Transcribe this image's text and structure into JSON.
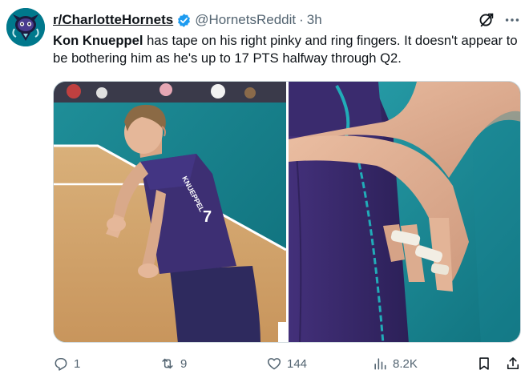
{
  "account": {
    "display_name": "r/CharlotteHornets",
    "handle": "@HornetsReddit",
    "separator": "·",
    "time": "3h"
  },
  "tweet": {
    "highlight": "Kon Knueppel",
    "text": " has tape on his right pinky and ring fingers. It doesn't appear to be bothering him as he's up to 17 PTS halfway through Q2."
  },
  "metrics": {
    "replies": "1",
    "reposts": "9",
    "likes": "144",
    "views": "8.2K"
  },
  "media": {
    "jersey_name": "KNUEPPEL",
    "jersey_number": "7"
  },
  "colors": {
    "accent": "#1d9bf0",
    "text_primary": "#0f1419",
    "text_secondary": "#536471",
    "team_teal": "#00788c",
    "team_purple": "#3d2f73"
  },
  "icons": [
    "verified-icon",
    "grok-icon",
    "more-icon",
    "reply-icon",
    "repost-icon",
    "like-icon",
    "views-icon",
    "bookmark-icon",
    "share-icon"
  ]
}
